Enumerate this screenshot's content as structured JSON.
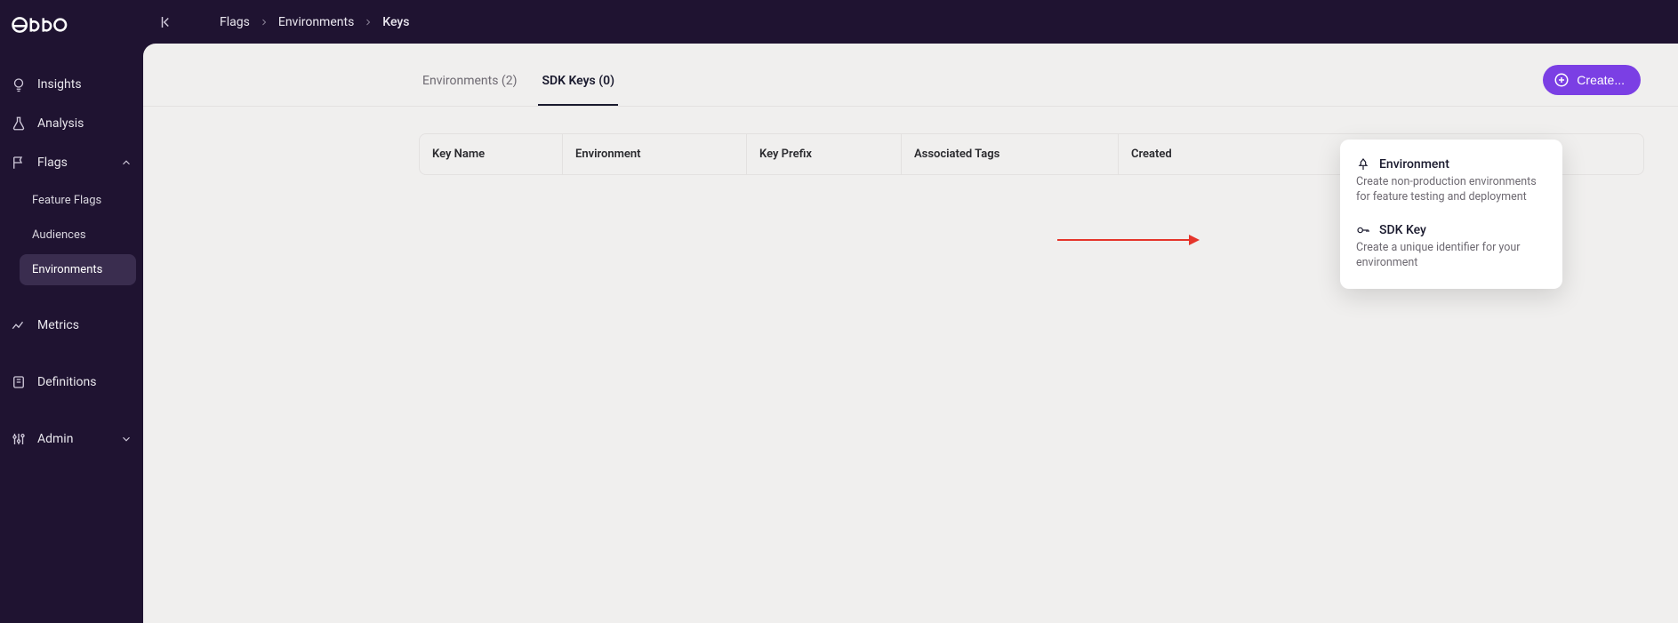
{
  "brand": "eppo",
  "sidebar": {
    "items": [
      {
        "label": "Insights"
      },
      {
        "label": "Analysis"
      },
      {
        "label": "Flags"
      },
      {
        "label": "Metrics"
      },
      {
        "label": "Definitions"
      },
      {
        "label": "Admin"
      }
    ],
    "flags_sub": [
      {
        "label": "Feature Flags"
      },
      {
        "label": "Audiences"
      },
      {
        "label": "Environments"
      }
    ]
  },
  "breadcrumb": {
    "items": [
      "Flags",
      "Environments",
      "Keys"
    ]
  },
  "tabs": {
    "items": [
      {
        "label": "Environments (2)"
      },
      {
        "label": "SDK Keys (0)"
      }
    ]
  },
  "create_button": "Create...",
  "table": {
    "headers": {
      "key_name": "Key Name",
      "environment": "Environment",
      "key_prefix": "Key Prefix",
      "tags": "Associated Tags",
      "created": "Created"
    }
  },
  "dropdown": {
    "environment": {
      "title": "Environment",
      "desc": "Create non-production environments for feature testing and deployment"
    },
    "sdk_key": {
      "title": "SDK Key",
      "desc": "Create a unique identifier for your environment"
    }
  }
}
